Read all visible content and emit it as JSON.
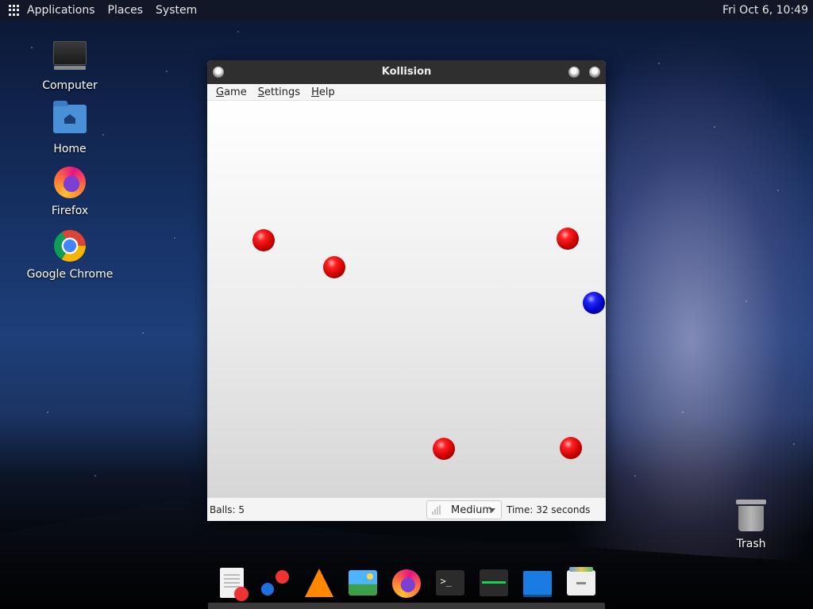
{
  "top_panel": {
    "menus": [
      "Applications",
      "Places",
      "System"
    ],
    "clock": "Fri Oct  6, 10:49"
  },
  "desktop_icons": [
    "Computer",
    "Home",
    "Firefox",
    "Google Chrome",
    "Trash"
  ],
  "window": {
    "title": "Kollision",
    "menus": [
      {
        "mnemonic": "G",
        "rest": "ame"
      },
      {
        "mnemonic": "S",
        "rest": "ettings"
      },
      {
        "mnemonic": "H",
        "rest": "elp"
      }
    ],
    "status": {
      "balls": "Balls: 5",
      "difficulty": "Medium",
      "time": "Time: 32 seconds"
    }
  },
  "dock": {
    "items": [
      "text-editor-icon",
      "dots-app-icon",
      "vlc-icon",
      "image-viewer-icon",
      "firefox-icon",
      "terminal-icon",
      "system-monitor-icon",
      "blue-app-icon",
      "file-manager-icon"
    ]
  },
  "colors": {
    "ball_red": "#d00000",
    "ball_blue": "#0000d0",
    "titlebar": "#2f2f2f"
  }
}
